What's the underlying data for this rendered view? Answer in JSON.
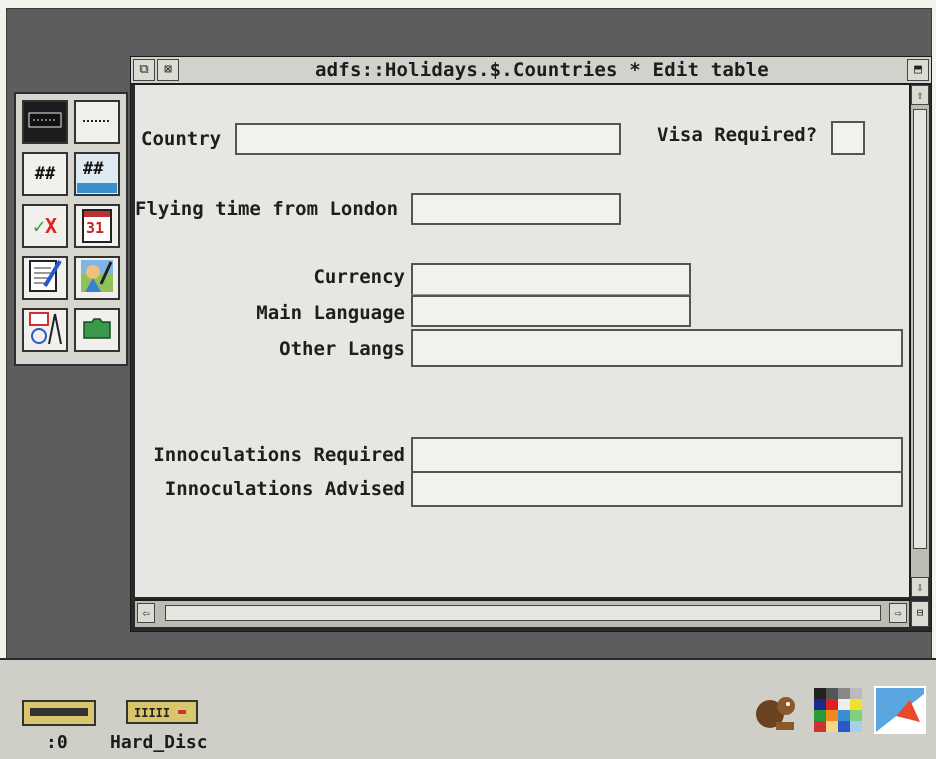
{
  "window": {
    "title": "adfs::Holidays.$.Countries * Edit table",
    "back_glyph": "⧉",
    "close_glyph": "⊠",
    "toggle_glyph": "⬒"
  },
  "scroll": {
    "up": "⇧",
    "down": "⇩",
    "left": "⇦",
    "right": "⇨",
    "adjust": "⊟"
  },
  "form": {
    "country_label": "Country",
    "country_value": "",
    "visa_label": "Visa Required?",
    "visa_value": "",
    "flying_label": "Flying time from London",
    "flying_value": "",
    "currency_label": "Currency",
    "currency_value": "",
    "language_label": "Main Language",
    "language_value": "",
    "other_langs_label": "Other Langs",
    "other_langs_value": "",
    "innoc_req_label": "Innoculations Required",
    "innoc_req_value": "",
    "innoc_adv_label": "Innoculations Advised",
    "innoc_adv_value": ""
  },
  "toolbox": {
    "tools": [
      {
        "icon": "text-field-icon"
      },
      {
        "icon": "dotted-field-icon"
      },
      {
        "icon": "number-field-icon",
        "glyph": "##"
      },
      {
        "icon": "number-field-alt-icon",
        "glyph": "##"
      },
      {
        "icon": "tick-cross-icon",
        "tick": "✓",
        "cross": "X"
      },
      {
        "icon": "calendar-icon",
        "glyph": "31"
      },
      {
        "icon": "notepad-icon"
      },
      {
        "icon": "paint-icon"
      },
      {
        "icon": "draw-tools-icon"
      },
      {
        "icon": "folder-icon"
      }
    ]
  },
  "iconbar": {
    "floppy_label": ":0",
    "harddisc_label": "Hard_Disc"
  }
}
